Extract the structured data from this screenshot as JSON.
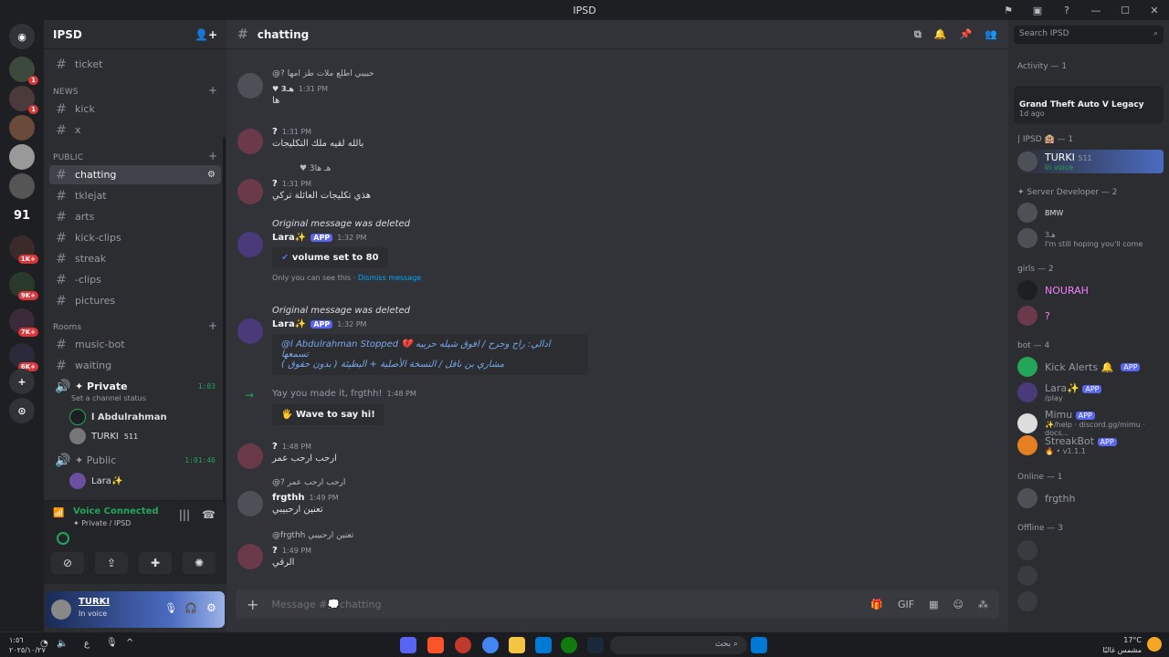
{
  "window": {
    "title": "IPSD"
  },
  "server": {
    "name": "IPSD",
    "rail_badges": [
      "1",
      "1",
      "1K+",
      "9K+",
      "7K+",
      "6K+"
    ],
    "rail_labels": [
      "91"
    ]
  },
  "sidebar": {
    "channels_top": [
      {
        "name": "ticket"
      },
      {
        "category": "NEWS"
      },
      {
        "name": "kick"
      },
      {
        "name": "x"
      },
      {
        "category": "PUBLIC"
      },
      {
        "name": "chatting",
        "active": true
      },
      {
        "name": "tklejat"
      },
      {
        "name": "arts"
      },
      {
        "name": "kick-clips"
      },
      {
        "name": "streak"
      },
      {
        "name": "-clips"
      },
      {
        "name": "pictures"
      },
      {
        "category": "Rooms"
      },
      {
        "name": "music-bot"
      },
      {
        "name": "waiting"
      }
    ],
    "voice_private": {
      "name": "✦ Private",
      "time": "1:03",
      "status": "Set a channel status",
      "users": [
        "l Abdulrahman",
        "TURKI",
        "511"
      ]
    },
    "voice_public": {
      "name": "✦ Public",
      "time": "1:01:46",
      "users": [
        "Lara✨"
      ]
    },
    "voice_connected": {
      "title": "Voice Connected",
      "location": "✦ Private / IPSD"
    },
    "user": {
      "name": "TURKI",
      "status": "In voice"
    }
  },
  "chat": {
    "channel": "chatting",
    "messages": [
      {
        "reply": "@? حبيبي اطلع ملات طز امها",
        "author": "",
        "time": "1:31 PM",
        "content": "ها",
        "tag": "♥ 3هـ"
      },
      {
        "author": "?",
        "time": "1:31 PM",
        "content": "بالله لقيه ملك التكليجات"
      },
      {
        "reply": "ها",
        "author": "?",
        "time": "1:31 PM",
        "content": "هذي تكليجات العائلة تركي",
        "tag": "♥ 3هـ"
      },
      {
        "deleted": "Original message was deleted",
        "author": "Lara✨",
        "app": "APP",
        "time": "1:32 PM",
        "embed": "volume set to 80",
        "ephemeral": "Only you can see this",
        "dismiss": "Dismiss message"
      },
      {
        "deleted": "Original message was deleted",
        "author": "Lara✨",
        "app": "APP",
        "time": "1:32 PM",
        "embed2_line1": "@l Abdulrahman Stopped 💔 ادالي: راح وجرح / افوق شيله حربيه تسمعها",
        "embed2_line2": "مشاري بن نافل / النسخة الأصلية + البطيئة ( بدون حقوق )"
      },
      {
        "join": "Yay you made it, frgthh!",
        "time": "1:48 PM",
        "wave": "Wave to say hi!"
      },
      {
        "author": "?",
        "time": "1:48 PM",
        "content": "ارحب ارحب عمر"
      },
      {
        "reply": "@? ارحب ارحب عمر",
        "author": "frgthh",
        "time": "1:49 PM",
        "content": "تعنين ارحبيبي"
      },
      {
        "reply": "@frgthh تعنين ارحبيبي",
        "author": "?",
        "time": "1:49 PM",
        "content": "الرقي"
      }
    ],
    "composer_placeholder": "Message #💭chatting"
  },
  "members": {
    "search_placeholder": "Search IPSD",
    "activity": {
      "header": "Activity — 1",
      "game": "Grand Theft Auto V Legacy",
      "ago": "1d ago"
    },
    "groups": [
      {
        "label": "| IPSD 🏨 — 1",
        "members": [
          {
            "name": "TURKI",
            "sub": "In voice",
            "tag": "511"
          }
        ]
      },
      {
        "label": "✦ Server Developer — 2",
        "members": [
          {
            "name": "BMW",
            "sub": ""
          },
          {
            "name": "3هـ",
            "sub": "I'm still hoping you'll come"
          }
        ]
      },
      {
        "label": "girls — 2",
        "members": [
          {
            "name": "NOURAH",
            "sub": ""
          },
          {
            "name": "?",
            "sub": ""
          }
        ]
      },
      {
        "label": "bot — 4",
        "members": [
          {
            "name": "Kick Alerts 🔔",
            "sub": "",
            "app": "APP"
          },
          {
            "name": "Lara✨",
            "sub": "/play",
            "app": "APP"
          },
          {
            "name": "Mimu",
            "sub": "✨/help · discord.gg/mimu · docs...",
            "app": "APP"
          },
          {
            "name": "StreakBot",
            "sub": "🔥 • v1.1.1",
            "app": "APP"
          }
        ]
      },
      {
        "label": "Online — 1",
        "members": [
          {
            "name": "frgthh",
            "sub": ""
          }
        ]
      },
      {
        "label": "Offline — 3",
        "members": []
      }
    ]
  },
  "taskbar": {
    "search": "بحث",
    "time": "١:٥٦",
    "date": "٢٠٢٥/١٠/٢٧",
    "weather_temp": "17°C",
    "weather_desc": "مشمس غالبًا",
    "lang": "ع"
  },
  "colors": {
    "accent": "#5865f2",
    "bg_main": "#313338",
    "bg_sidebar": "#2b2d31",
    "bg_rail": "#1e1f22",
    "green": "#23a55a",
    "red": "#da373c"
  }
}
